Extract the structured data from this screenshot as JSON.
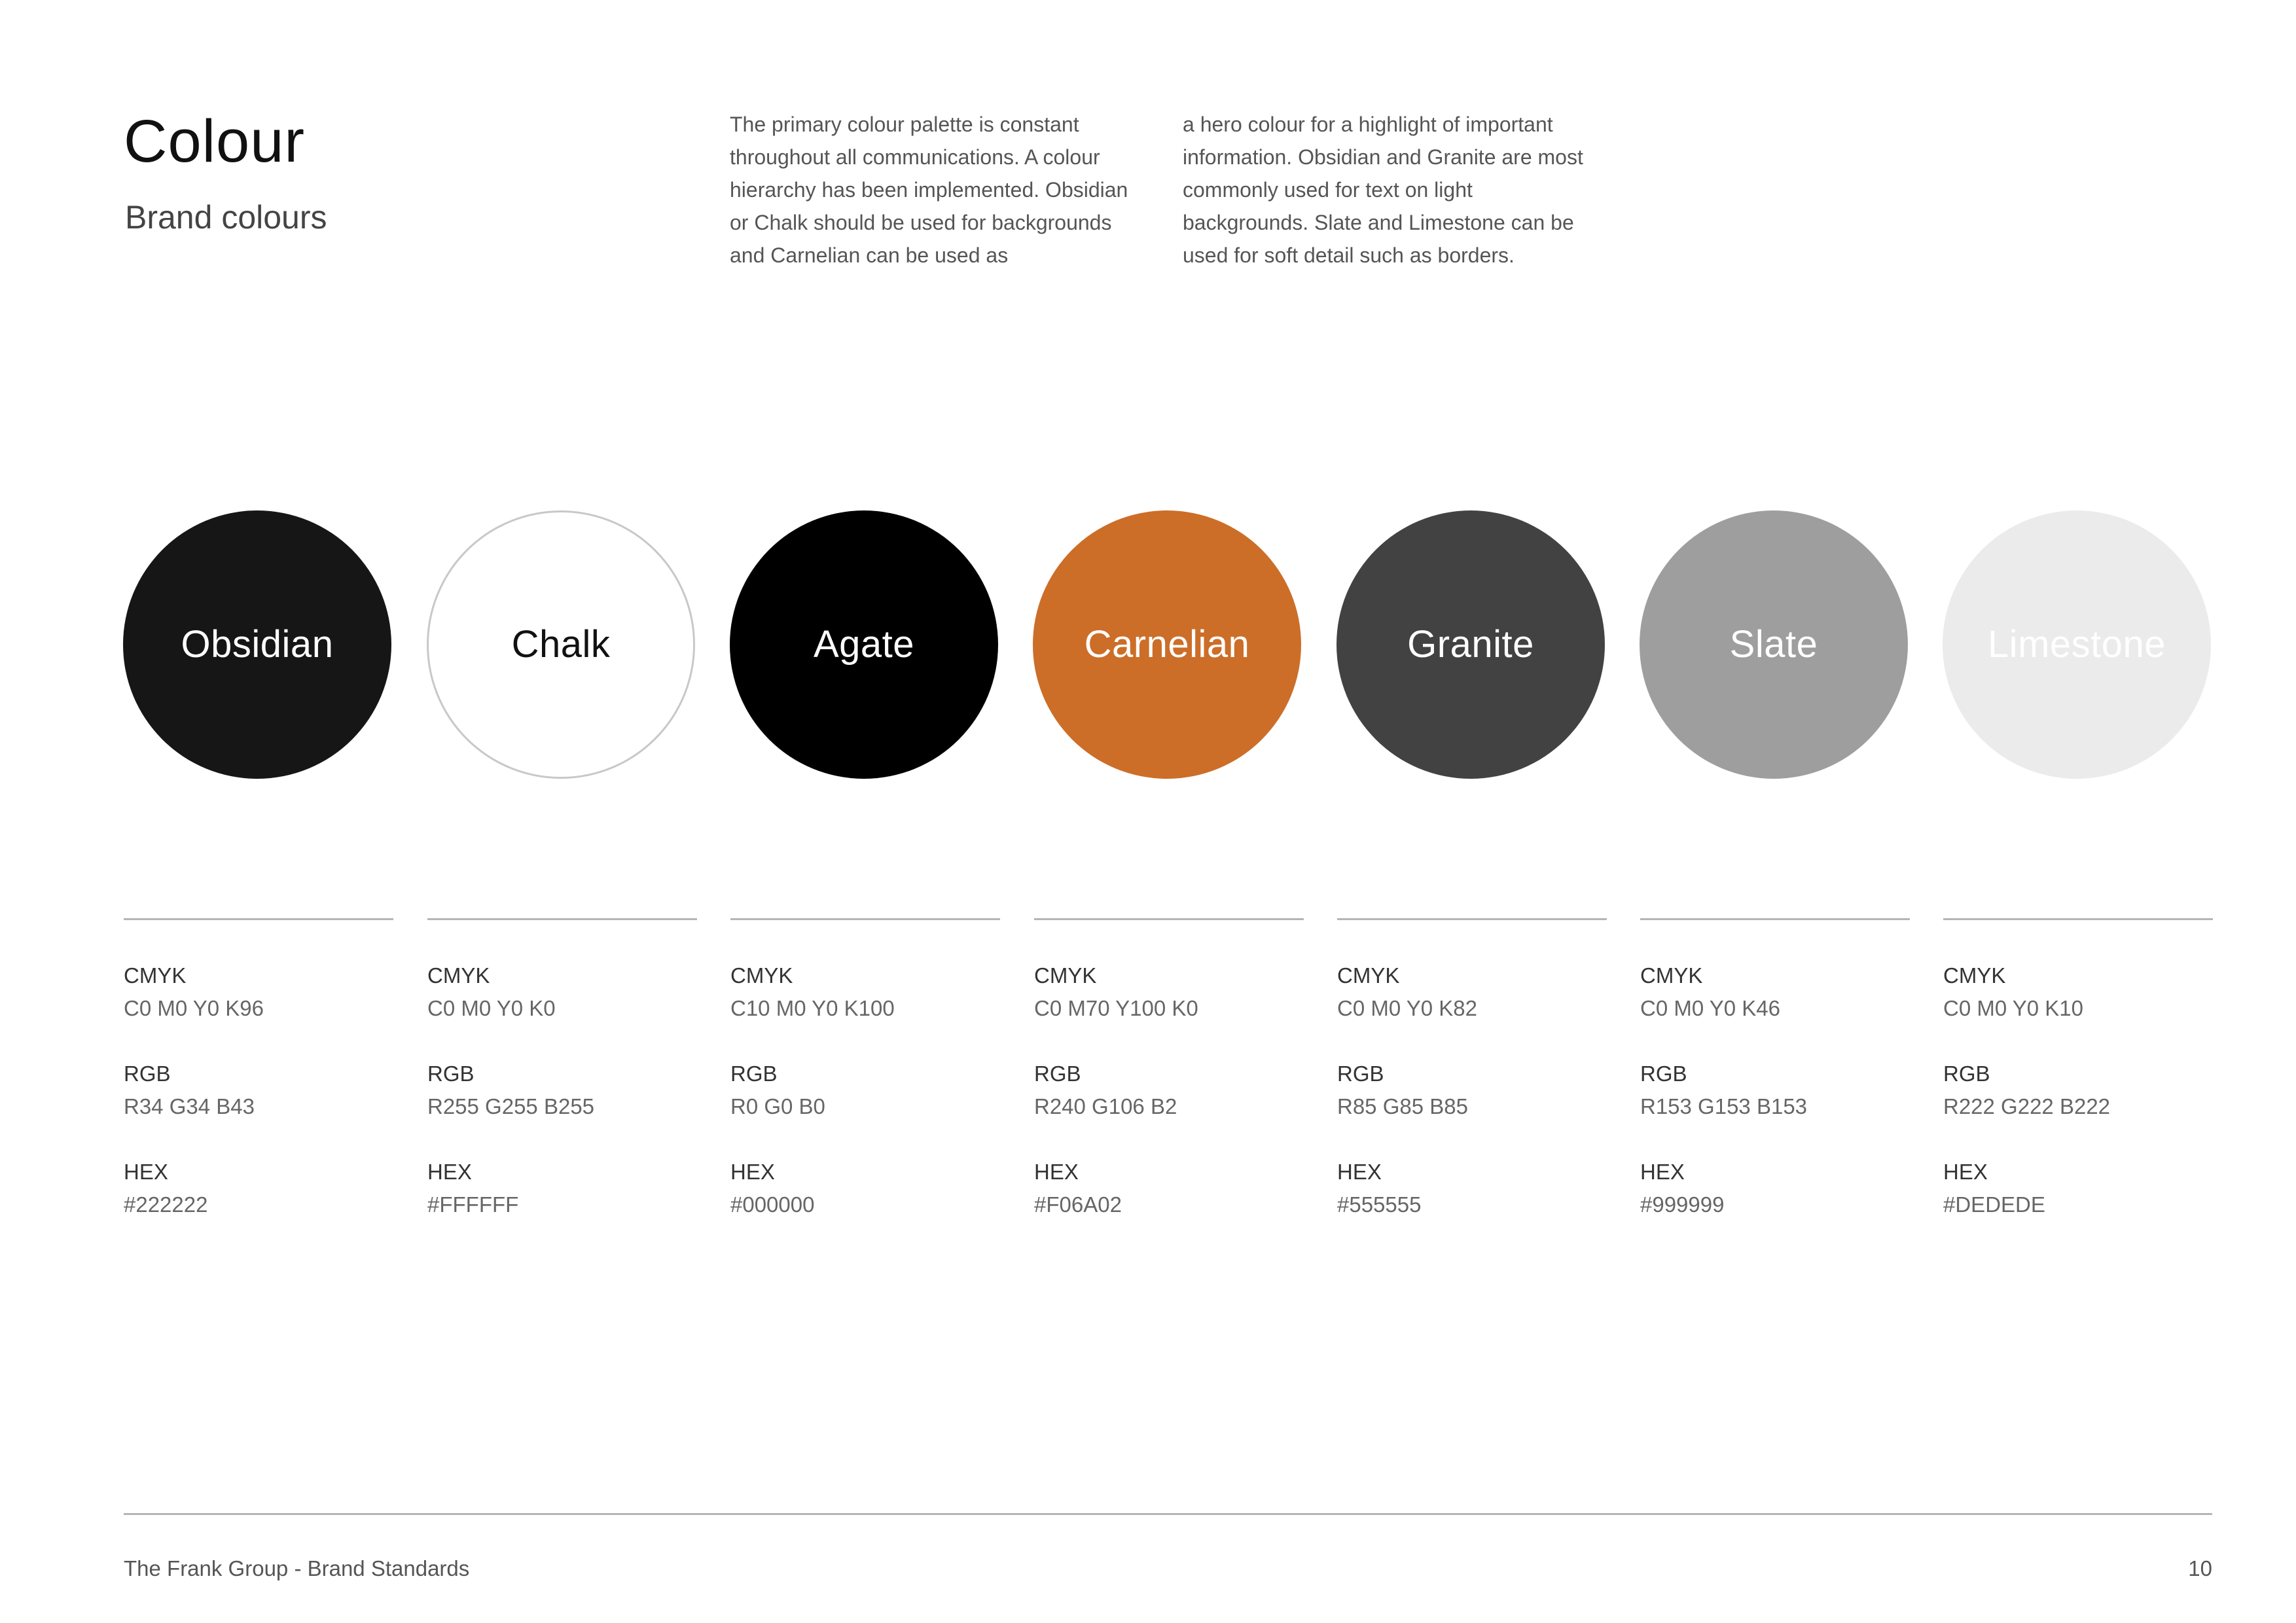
{
  "header": {
    "title": "Colour",
    "subtitle": "Brand colours"
  },
  "intro": {
    "col1": "The primary colour palette is constant throughout all communications. A colour hierarchy has been implemented. Obsidian or Chalk should be used for backgrounds and Carnelian can be used as",
    "col2": "a hero colour for a highlight of important information. Obsidian and Granite are most commonly used for text on light backgrounds. Slate and Limestone can be used for soft detail such as borders."
  },
  "spec_labels": {
    "cmyk": "CMYK",
    "rgb": "RGB",
    "hex": "HEX"
  },
  "swatches": [
    {
      "name": "Obsidian",
      "fill": "#161616",
      "text_color": "#ffffff",
      "border": "none",
      "cmyk": "C0 M0 Y0 K96",
      "rgb": "R34 G34 B43",
      "hex": "#222222"
    },
    {
      "name": "Chalk",
      "fill": "#ffffff",
      "text_color": "#111111",
      "border": "#c8c8c8",
      "cmyk": "C0 M0 Y0 K0",
      "rgb": "R255 G255 B255",
      "hex": "#FFFFFF"
    },
    {
      "name": "Agate",
      "fill": "#000000",
      "text_color": "#ffffff",
      "border": "none",
      "cmyk": "C10 M0 Y0 K100",
      "rgb": "R0 G0 B0",
      "hex": "#000000"
    },
    {
      "name": "Carnelian",
      "fill": "#cc6e28",
      "text_color": "#ffffff",
      "border": "none",
      "cmyk": "C0 M70 Y100 K0",
      "rgb": "R240 G106 B2",
      "hex": "#F06A02"
    },
    {
      "name": "Granite",
      "fill": "#424242",
      "text_color": "#ffffff",
      "border": "none",
      "cmyk": "C0 M0 Y0 K82",
      "rgb": "R85 G85 B85",
      "hex": "#555555"
    },
    {
      "name": "Slate",
      "fill": "#9e9e9e",
      "text_color": "#ffffff",
      "border": "none",
      "cmyk": "C0 M0 Y0 K46",
      "rgb": "R153 G153 B153",
      "hex": "#999999"
    },
    {
      "name": "Limestone",
      "fill": "#ebebeb",
      "text_color": "#ffffff",
      "border": "none",
      "cmyk": "C0 M0 Y0 K10",
      "rgb": "R222 G222 B222",
      "hex": "#DEDEDE"
    }
  ],
  "footer": {
    "doc_title": "The Frank Group - Brand Standards",
    "page_number": "10"
  }
}
